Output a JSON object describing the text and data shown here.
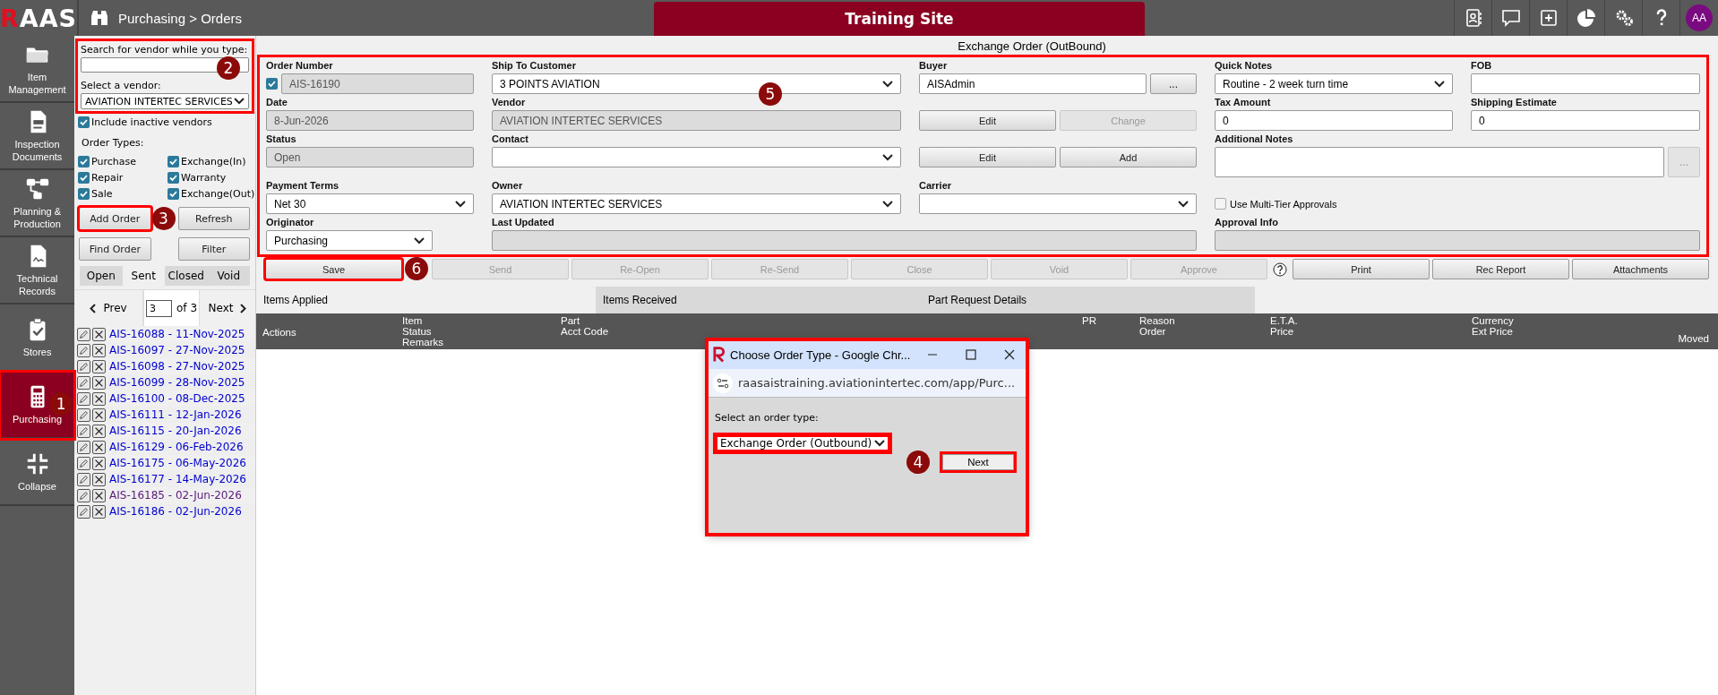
{
  "topbar": {
    "logo": "RAAS",
    "breadcrumb": "Purchasing > Orders",
    "site_label": "Training Site",
    "avatar": "AA"
  },
  "sidebar": {
    "items": [
      {
        "label": "Item Management",
        "selected": false,
        "highlighted": false
      },
      {
        "label": "Inspection Documents",
        "selected": false,
        "highlighted": false
      },
      {
        "label": "Planning & Production",
        "selected": false,
        "highlighted": false
      },
      {
        "label": "Technical Records",
        "selected": false,
        "highlighted": false
      },
      {
        "label": "Stores",
        "selected": false,
        "highlighted": false
      },
      {
        "label": "Purchasing",
        "selected": true,
        "highlighted": true,
        "badge": "1"
      },
      {
        "label": "Collapse",
        "selected": false,
        "highlighted": false
      }
    ]
  },
  "vendor_panel": {
    "highlighted": true,
    "badge": "2",
    "search_label": "Search for vendor while you type:",
    "select_label": "Select a vendor:",
    "select_value": "AVIATION INTERTEC SERVICES"
  },
  "include_inactive": {
    "label": "Include inactive vendors",
    "checked": true
  },
  "order_types": {
    "label": "Order Types:",
    "options": [
      {
        "label": "Purchase",
        "checked": true
      },
      {
        "label": "Exchange(In)",
        "checked": true
      },
      {
        "label": "Repair",
        "checked": true
      },
      {
        "label": "Warranty",
        "checked": true
      },
      {
        "label": "Sale",
        "checked": true
      },
      {
        "label": "Exchange(Out)",
        "checked": true
      }
    ]
  },
  "panel_buttons": [
    {
      "label": "Add Order",
      "highlighted": true,
      "badge": "3"
    },
    {
      "label": "Refresh",
      "highlighted": false
    },
    {
      "label": "Find Order",
      "highlighted": false
    },
    {
      "label": "Filter",
      "highlighted": false
    }
  ],
  "status_tabs": [
    {
      "label": "Open",
      "selected": false
    },
    {
      "label": "Sent",
      "selected": true
    },
    {
      "label": "Closed",
      "selected": false
    },
    {
      "label": "Void",
      "selected": false
    }
  ],
  "pager": {
    "prev": "Prev",
    "page": "3",
    "of": "of 3",
    "next": "Next"
  },
  "orders": [
    {
      "label": "AIS-16088 - 11-Nov-2025",
      "visited": false
    },
    {
      "label": "AIS-16097 - 27-Nov-2025",
      "visited": false
    },
    {
      "label": "AIS-16098 - 27-Nov-2025",
      "visited": false
    },
    {
      "label": "AIS-16099 - 28-Nov-2025",
      "visited": false
    },
    {
      "label": "AIS-16100 - 08-Dec-2025",
      "visited": false
    },
    {
      "label": "AIS-16111 - 12-Jan-2026",
      "visited": false
    },
    {
      "label": "AIS-16115 - 20-Jan-2026",
      "visited": false
    },
    {
      "label": "AIS-16129 - 06-Feb-2026",
      "visited": false
    },
    {
      "label": "AIS-16175 - 06-May-2026",
      "visited": false
    },
    {
      "label": "AIS-16177 - 14-May-2026",
      "visited": false
    },
    {
      "label": "AIS-16185 - 02-Jun-2026",
      "visited": true
    },
    {
      "label": "AIS-16186 - 02-Jun-2026",
      "visited": false
    }
  ],
  "order_form": {
    "title": "Exchange Order (OutBound)",
    "highlighted": true,
    "badge": "5",
    "order_number": {
      "label": "Order Number",
      "value": "AIS-16190",
      "checked": true
    },
    "ship_to_customer": {
      "label": "Ship To Customer",
      "value": "3 POINTS AVIATION"
    },
    "buyer": {
      "label": "Buyer",
      "value": "AISAdmin",
      "button": "..."
    },
    "quick_notes": {
      "label": "Quick Notes",
      "value": "Routine - 2 week turn time"
    },
    "fob": {
      "label": "FOB"
    },
    "date": {
      "label": "Date",
      "value": "8-Jun-2026"
    },
    "vendor": {
      "label": "Vendor",
      "value": "AVIATION INTERTEC SERVICES"
    },
    "vendor_buttons": [
      {
        "label": "Edit",
        "disabled": false
      },
      {
        "label": "Change",
        "disabled": true
      }
    ],
    "tax_amount": {
      "label": "Tax Amount",
      "value": "0"
    },
    "shipping_estimate": {
      "label": "Shipping Estimate",
      "value": "0"
    },
    "status": {
      "label": "Status",
      "value": "Open"
    },
    "contact": {
      "label": "Contact"
    },
    "contact_buttons": [
      {
        "label": "Edit",
        "disabled": false
      },
      {
        "label": "Add",
        "disabled": false
      }
    ],
    "additional_notes": {
      "label": "Additional Notes",
      "button": "..."
    },
    "payment_terms": {
      "label": "Payment Terms",
      "value": "Net 30"
    },
    "owner": {
      "label": "Owner",
      "value": "AVIATION INTERTEC SERVICES"
    },
    "carrier": {
      "label": "Carrier"
    },
    "multi_tier": {
      "label": "Use Multi-Tier Approvals",
      "checked": false
    },
    "originator": {
      "label": "Originator",
      "value": "Purchasing"
    },
    "last_updated": {
      "label": "Last Updated"
    },
    "approval_info": {
      "label": "Approval Info"
    }
  },
  "actions": [
    {
      "label": "Save",
      "disabled": false,
      "highlighted": true,
      "badge": "6"
    },
    {
      "label": "Send",
      "disabled": true,
      "highlighted": false
    },
    {
      "label": "Re-Open",
      "disabled": true,
      "highlighted": false
    },
    {
      "label": "Re-Send",
      "disabled": true,
      "highlighted": false
    },
    {
      "label": "Close",
      "disabled": true,
      "highlighted": false
    },
    {
      "label": "Void",
      "disabled": true,
      "highlighted": false
    },
    {
      "label": "Approve",
      "disabled": true,
      "highlighted": false
    }
  ],
  "reports": [
    {
      "label": "Print",
      "disabled": false
    },
    {
      "label": "Rec Report",
      "disabled": false
    },
    {
      "label": "Attachments",
      "disabled": false
    }
  ],
  "detail_tabs": [
    {
      "label": "Items Applied",
      "selected": true
    },
    {
      "label": "Items Received",
      "selected": false
    },
    {
      "label": "Part Request Details",
      "selected": false
    }
  ],
  "columns": [
    {
      "lines": [
        "Actions"
      ]
    },
    {
      "lines": [
        "Item",
        "Status",
        "Remarks"
      ]
    },
    {
      "lines": [
        "Part",
        "Acct Code"
      ]
    },
    {
      "lines": [
        "PR"
      ]
    },
    {
      "lines": [
        "Reason",
        "Order"
      ]
    },
    {
      "lines": [
        "E.T.A.",
        "Price"
      ]
    },
    {
      "lines": [
        "Currency",
        "Ext Price"
      ]
    },
    {
      "lines": [
        "Moved"
      ]
    }
  ],
  "dialog": {
    "highlighted": true,
    "title": "Choose Order Type - Google Chr...",
    "url": "raasaistraining.aviationintertec.com/app/Purc...",
    "prompt": "Select an order type:",
    "order_type": {
      "value": "Exchange Order (Outbound)",
      "highlighted": true
    },
    "next": {
      "label": "Next",
      "highlighted": true,
      "badge": "4"
    }
  }
}
